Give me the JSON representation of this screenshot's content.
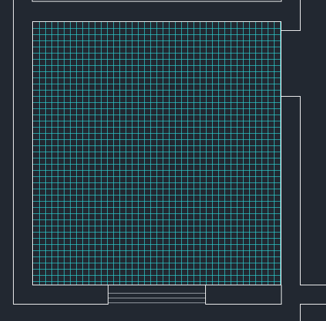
{
  "colors": {
    "background": "#222831",
    "wall_line": "#ffffff",
    "grid_line": "#2ecfd0",
    "step_line": "#9aa0a6"
  },
  "view": {
    "type": "cad-floor-plan",
    "content": "tiled-room-grid"
  }
}
